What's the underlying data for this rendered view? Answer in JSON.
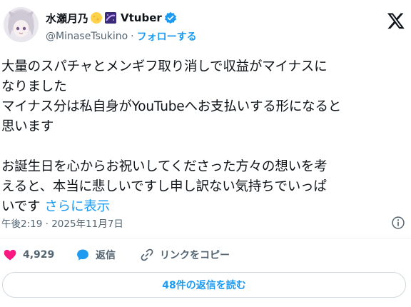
{
  "author": {
    "display_name": "水瀬月乃",
    "name_suffix": "Vtuber",
    "handle": "@MinaseTsukino",
    "separator": "·",
    "follow_label": "フォローする",
    "verified_color": "#1d9bf0"
  },
  "tweet": {
    "lines": [
      "大量のスパチャとメンギフ取り消しで収益がマイナスに",
      "なりました",
      "マイナス分は私自身がYouTubeへお支払いする形になると",
      "思います",
      "",
      "お誕生日を心からお祝いしてくださった方々の想いを考",
      "えると、本当に悲しいですし申し訳ない気持ちでいっぱ",
      "いです"
    ],
    "show_more": "さらに表示",
    "timestamp": "午後2:19 · 2025年11月7日"
  },
  "actions": {
    "like_count": "4,929",
    "reply_label": "返信",
    "copy_link_label": "リンクをコピー"
  },
  "replies_button": "48件の返信を読む",
  "colors": {
    "accent": "#1d9bf0",
    "like": "#f91880",
    "text": "#0f1419",
    "muted": "#536471"
  }
}
